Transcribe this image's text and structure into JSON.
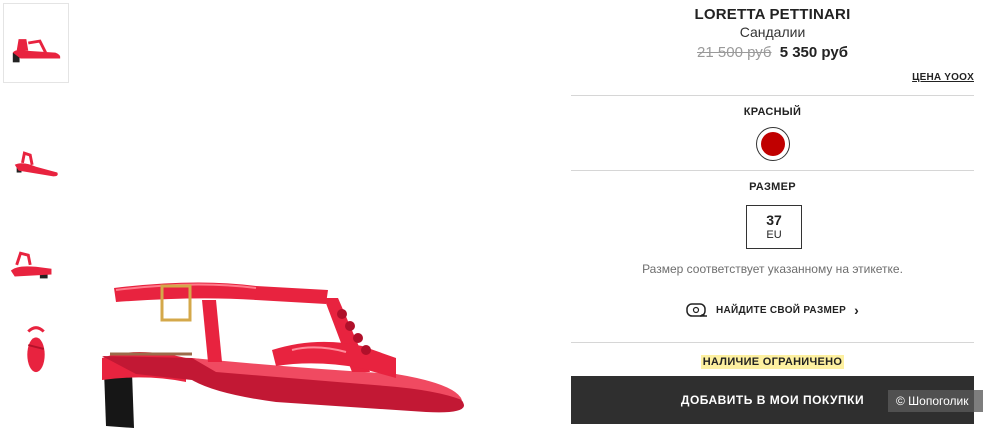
{
  "product": {
    "brand": "LORETTA PETTINARI",
    "category": "Сандалии",
    "old_price": "21 500 руб",
    "new_price": "5 350 руб",
    "price_link": "ЦЕНА YOOX"
  },
  "color": {
    "label": "КРАСНЫЙ",
    "swatch_hex": "#c00000"
  },
  "size": {
    "label": "РАЗМЕР",
    "value": "37",
    "system": "EU",
    "note": "Размер соответствует указанному на этикетке.",
    "finder_label": "НАЙДИТЕ СВОЙ РАЗМЕР"
  },
  "availability": "НАЛИЧИЕ ОГРАНИЧЕНО",
  "cta": {
    "add_label": "ДОБАВИТЬ В МОИ ПОКУПКИ"
  },
  "watermark": "© Шопоголик",
  "colors": {
    "shoe_red": "#e8233f",
    "button_bg": "#2f2f2f",
    "highlight": "#fdf0a0"
  }
}
